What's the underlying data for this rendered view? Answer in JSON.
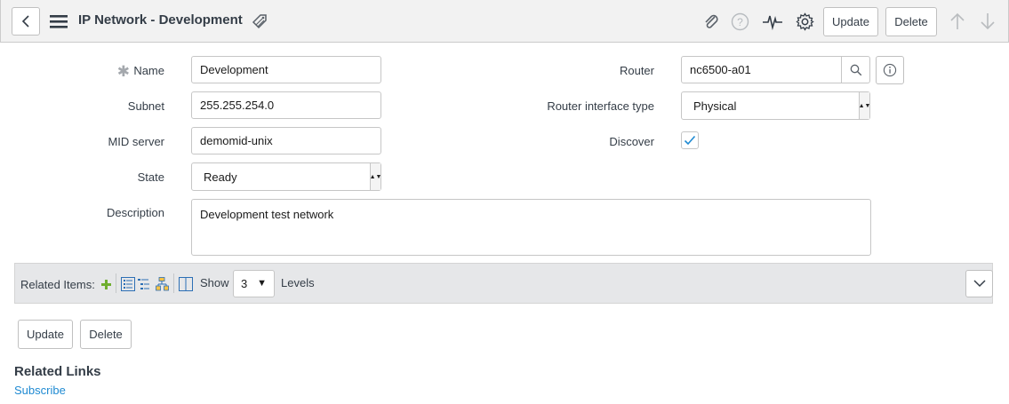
{
  "header": {
    "title": "IP Network - Development",
    "update_label": "Update",
    "delete_label": "Delete"
  },
  "form": {
    "name": {
      "label": "Name",
      "value": "Development",
      "required_mark": "✱"
    },
    "subnet": {
      "label": "Subnet",
      "value": "255.255.254.0"
    },
    "mid_server": {
      "label": "MID server",
      "value": "demomid-unix"
    },
    "state": {
      "label": "State",
      "value": "Ready"
    },
    "description": {
      "label": "Description",
      "value": "Development test network"
    },
    "router": {
      "label": "Router",
      "value": "nc6500-a01"
    },
    "router_interface_type": {
      "label": "Router interface type",
      "value": "Physical"
    },
    "discover": {
      "label": "Discover",
      "checked": true
    }
  },
  "related_items": {
    "label": "Related Items:",
    "show_label": "Show",
    "levels_value": "3",
    "levels_label": "Levels"
  },
  "footer": {
    "update_label": "Update",
    "delete_label": "Delete"
  },
  "related_links": {
    "heading": "Related Links",
    "subscribe": "Subscribe"
  },
  "colors": {
    "accent_link": "#1f8ad2",
    "check": "#1f8ad2",
    "add_icon": "#6fae2f"
  }
}
